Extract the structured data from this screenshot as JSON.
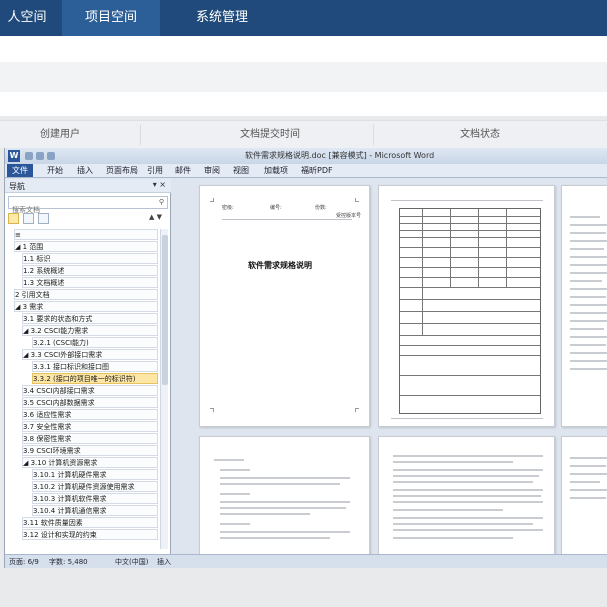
{
  "topnav": {
    "items": [
      {
        "label": "人空间",
        "active": false
      },
      {
        "label": "项目空间",
        "active": true
      },
      {
        "label": "系统管理",
        "active": false
      }
    ],
    "bg_color": "#1f4a7b",
    "active_color": "#2c5f97"
  },
  "table": {
    "headers": [
      "创建用户",
      "文档提交时间",
      "文档状态"
    ]
  },
  "word": {
    "app_icon": "W",
    "title": "软件需求规格说明.doc [兼容模式] - Microsoft Word",
    "ribbon_tabs": [
      "文件",
      "开始",
      "插入",
      "页面布局",
      "引用",
      "邮件",
      "审阅",
      "视图",
      "加载项",
      "福昕PDF"
    ],
    "nav": {
      "title": "导航",
      "close": "▾ ×",
      "search_placeholder": "搜索文档",
      "search_icon": "search-icon",
      "arrows": "▲ ▼",
      "items": [
        {
          "label": "≡",
          "level": 0
        },
        {
          "label": "◢ 1  范围",
          "level": 0
        },
        {
          "label": "1.1  标识",
          "level": 1
        },
        {
          "label": "1.2  系统概述",
          "level": 1
        },
        {
          "label": "1.3  文档概述",
          "level": 1
        },
        {
          "label": "2  引用文档",
          "level": 0
        },
        {
          "label": "◢ 3  需求",
          "level": 0
        },
        {
          "label": "3.1  要求的状态和方式",
          "level": 1
        },
        {
          "label": "◢ 3.2  CSCI能力需求",
          "level": 1
        },
        {
          "label": "3.2.1  (CSCI能力)",
          "level": 2
        },
        {
          "label": "◢ 3.3  CSCI外部接口需求",
          "level": 1
        },
        {
          "label": "3.3.1  接口标识和接口图",
          "level": 2
        },
        {
          "label": "3.3.2  (接口的项目唯一的标识符)",
          "level": 2,
          "selected": true
        },
        {
          "label": "3.4  CSCI内部接口需求",
          "level": 1
        },
        {
          "label": "3.5  CSCI内部数据需求",
          "level": 1
        },
        {
          "label": "3.6  适应性需求",
          "level": 1
        },
        {
          "label": "3.7  安全性需求",
          "level": 1
        },
        {
          "label": "3.8  保密性需求",
          "level": 1
        },
        {
          "label": "3.9  CSCI环境需求",
          "level": 1
        },
        {
          "label": "◢ 3.10  计算机资源需求",
          "level": 1
        },
        {
          "label": "3.10.1  计算机硬件需求",
          "level": 2
        },
        {
          "label": "3.10.2  计算机硬件资源使用需求",
          "level": 2
        },
        {
          "label": "3.10.3  计算机软件需求",
          "level": 2
        },
        {
          "label": "3.10.4  计算机通信需求",
          "level": 2
        },
        {
          "label": "3.11  软件质量因素",
          "level": 1
        },
        {
          "label": "3.12  设计和实现的约束",
          "level": 1
        }
      ]
    },
    "status": {
      "page": "页面: 6/9",
      "words": "字数: 5,480",
      "lang": "中文(中国)",
      "mode": "插入"
    },
    "page1": {
      "header_left": "密级:",
      "header_mid": "编号:",
      "header_right": "份数:",
      "top_right": "受控版本号",
      "doc_title": "软件需求规格说明"
    }
  }
}
